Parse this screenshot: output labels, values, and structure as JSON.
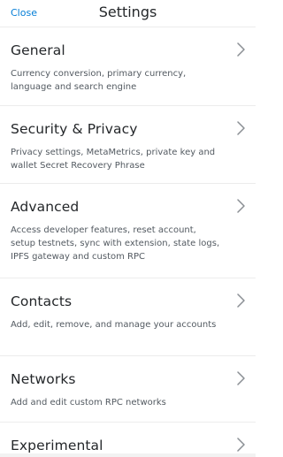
{
  "header": {
    "close_label": "Close",
    "title": "Settings"
  },
  "settings": [
    {
      "title": "General",
      "description": "Currency conversion, primary currency, language and search engine"
    },
    {
      "title": "Security & Privacy",
      "description": "Privacy settings, MetaMetrics, private key and wallet Secret Recovery Phrase"
    },
    {
      "title": "Advanced",
      "description": "Access developer features, reset account, setup testnets, sync with extension, state logs, IPFS gateway and custom RPC"
    },
    {
      "title": "Contacts",
      "description": "Add, edit, remove, and manage your accounts"
    },
    {
      "title": "Networks",
      "description": "Add and edit custom RPC networks"
    },
    {
      "title": "Experimental",
      "description": ""
    }
  ],
  "colors": {
    "accent": "#037dd6",
    "title_text": "#24272a",
    "description_text": "#535a61",
    "divider": "#ececec",
    "chevron": "#8a8f94"
  },
  "icons": {
    "chevron": "chevron-right-icon"
  }
}
